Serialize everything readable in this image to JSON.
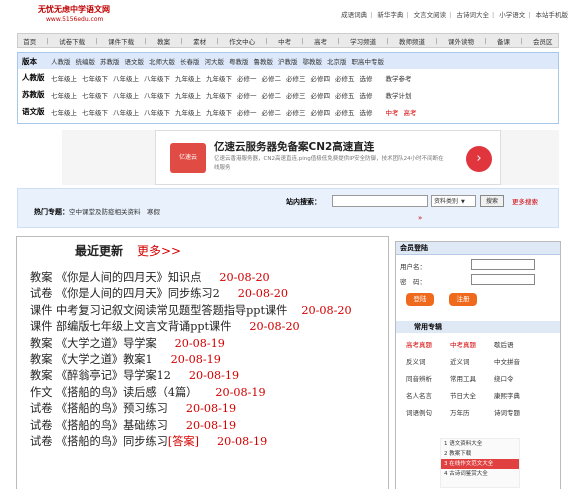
{
  "site": {
    "name": "无忧无虑中学语文网",
    "url": "www.5156edu.com"
  },
  "toplinks": [
    "成语词典",
    "新华字典",
    "文言文阅读",
    "古诗词大全",
    "小学语文",
    "本站手机版"
  ],
  "nav": [
    "首页",
    "试卷下载",
    "课件下载",
    "教案",
    "素材",
    "作文中心",
    "中考",
    "高考",
    "学习频道",
    "教师频道",
    "课外读物",
    "备课",
    "会员区"
  ],
  "versions": {
    "header_label": "版本",
    "header_items": [
      "人教版",
      "统编版",
      "苏教版",
      "语文版",
      "北师大版",
      "长春版",
      "河大版",
      "粤教版",
      "鲁教版",
      "沪教版",
      "鄂教版",
      "北京版",
      "职高中专版"
    ],
    "rows": [
      {
        "label": "人教版",
        "items": [
          "七年级上",
          "七年级下",
          "八年级上",
          "八年级下",
          "九年级上",
          "九年级下",
          "必修一",
          "必修二",
          "必修三",
          "必修四",
          "必修五",
          "选修",
          "教学参考"
        ]
      },
      {
        "label": "苏教版",
        "items": [
          "七年级上",
          "七年级下",
          "八年级上",
          "八年级下",
          "九年级上",
          "九年级下",
          "必修一",
          "必修二",
          "必修三",
          "必修四",
          "必修五",
          "选修",
          "教学计划"
        ]
      },
      {
        "label": "语文版",
        "items": [
          "七年级上",
          "七年级下",
          "八年级上",
          "八年级下",
          "九年级上",
          "九年级下",
          "必修一",
          "必修二",
          "必修三",
          "必修四",
          "必修五",
          "选修",
          "中考",
          "高考"
        ]
      }
    ]
  },
  "ad": {
    "title": "亿速云服务器免备案CN2高速直连",
    "desc": "亿速云香港服务器，CN2高速直连,ping值极低免费提供IP安全防御，技术团队24小时不间断在线服务",
    "logo": "亿速云",
    "go": "›"
  },
  "hot": {
    "label": "热门专题：",
    "text": "空中课堂及防疫相关资料　寒假"
  },
  "search": {
    "label": "站内搜索：",
    "type": "资料类别",
    "type_arrow": "▼",
    "button": "搜索",
    "advanced": "更多搜索",
    "more": "»"
  },
  "latest": {
    "title": "最近更新",
    "more": "更多>>",
    "items": [
      {
        "cat": "教案",
        "title": "《你是人间的四月天》知识点",
        "date": "20-08-20"
      },
      {
        "cat": "试卷",
        "title": "《你是人间的四月天》同步练习2",
        "date": "20-08-20"
      },
      {
        "cat": "课件",
        "title": "中考复习记叙文阅读常见题型答题指导ppt课件",
        "date": "20-08-20"
      },
      {
        "cat": "课件",
        "title": "部编版七年级上文言文背诵ppt课件",
        "date": "20-08-20"
      },
      {
        "cat": "教案",
        "title": "《大学之道》导学案",
        "date": "20-08-19"
      },
      {
        "cat": "教案",
        "title": "《大学之道》教案1",
        "date": "20-08-19"
      },
      {
        "cat": "教案",
        "title": "《醉翁亭记》导学案12",
        "date": "20-08-19"
      },
      {
        "cat": "作文",
        "title": "《搭船的鸟》读后感（4篇）",
        "date": "20-08-19"
      },
      {
        "cat": "试卷",
        "title": "《搭船的鸟》预习练习",
        "date": "20-08-19"
      },
      {
        "cat": "试卷",
        "title": "《搭船的鸟》基础练习",
        "date": "20-08-19"
      },
      {
        "cat": "试卷",
        "title": "《搭船的鸟》同步练习",
        "answer": "[答案]",
        "date": "20-08-19"
      }
    ]
  },
  "member": {
    "header": "会员登陆",
    "user_label": "用户名：",
    "pass_label": "密　码：",
    "login": "登陆",
    "register": "注册"
  },
  "common": {
    "header": "常用专辑",
    "rows": [
      [
        "高考真题",
        "中考真题",
        "歇后语"
      ],
      [
        "反义词",
        "近义词",
        "中文拼音"
      ],
      [
        "同音辨析",
        "常用工具",
        "绕口令"
      ],
      [
        "名人名言",
        "节日大全",
        "康熙字典"
      ],
      [
        "词语例句",
        "万年历",
        "诗词专题"
      ]
    ]
  },
  "ranking": [
    "1 语文资料大全",
    "2 教案下载",
    "3 在线作文范文大全",
    "4 古诗词鉴赏大全"
  ]
}
